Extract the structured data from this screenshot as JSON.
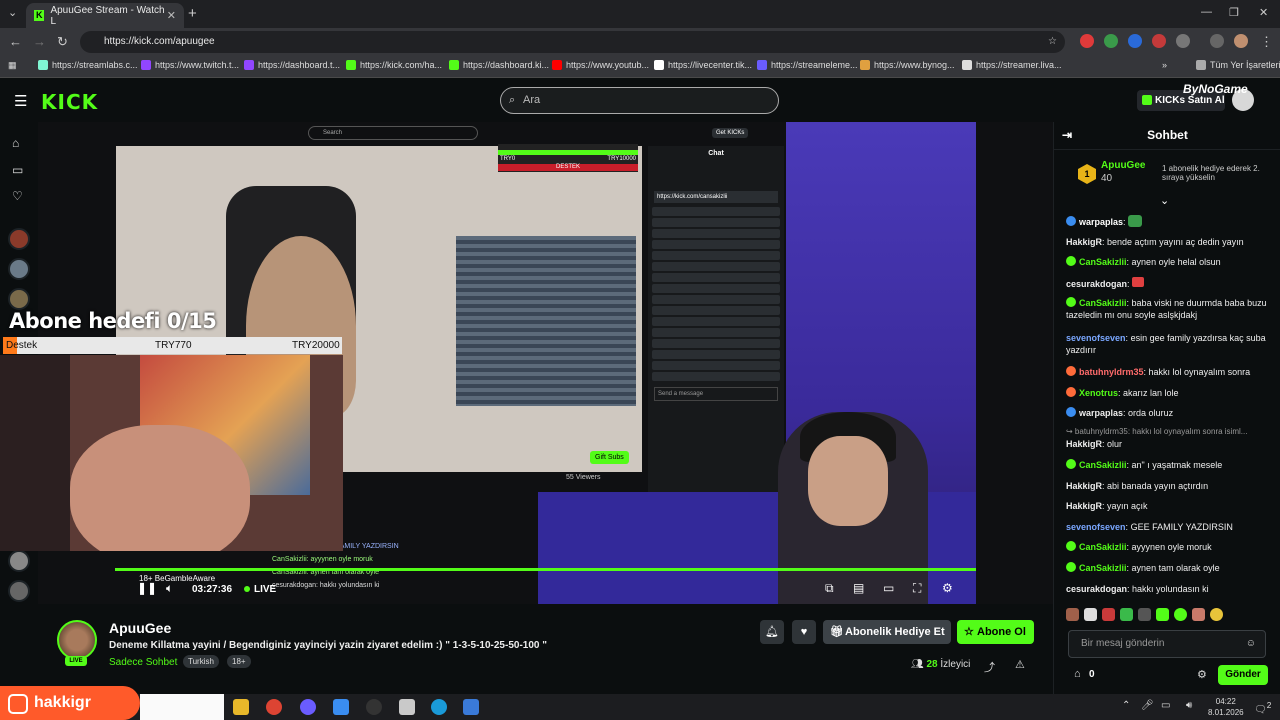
{
  "browser": {
    "tab_title": "ApuuGee Stream - Watch L",
    "tab_close": "✕",
    "new_tab": "+",
    "url": "https://kick.com/apuugee",
    "bookmarks": [
      {
        "label": "https://streamlabs.c...",
        "color": "#80f5d2"
      },
      {
        "label": "https://www.twitch.t...",
        "color": "#9146ff"
      },
      {
        "label": "https://dashboard.t...",
        "color": "#9146ff"
      },
      {
        "label": "https://kick.com/ha...",
        "color": "#53fc18"
      },
      {
        "label": "https://dashboard.ki...",
        "color": "#53fc18"
      },
      {
        "label": "https://www.youtub...",
        "color": "#ff0000"
      },
      {
        "label": "https://livecenter.tik...",
        "color": "#ffffff"
      },
      {
        "label": "https://streameleme...",
        "color": "#6a5cff"
      },
      {
        "label": "https://www.bynog...",
        "color": "#e0a040"
      },
      {
        "label": "https://streamer.liva...",
        "color": "#dddddd"
      }
    ],
    "all_bookmarks": "Tüm Yer İşaretleri"
  },
  "header": {
    "logo": "KICK",
    "search_placeholder": "Ara",
    "kicks_button": "KICKs Satın Al",
    "overlay_brand": "ByNoGame"
  },
  "stream_overlay": {
    "goal_title": "Abone hedefi 0/15",
    "goal_label": "Destek",
    "goal_mid": "TRY770",
    "goal_max": "TRY20000",
    "goal_progress": 0.04,
    "inner_search": "Search",
    "inner_chat": "Chat",
    "inner_get_kicks": "Get KICKs",
    "inner_gift": "Gift Subs",
    "inner_viewers": "55 Viewers",
    "inner_send": "Send a message",
    "inner_link": "https://kick.com/cansakizlii",
    "inner_bar_left": "TRY0",
    "inner_bar_right": "TRY10000",
    "inner_bar_label": "DESTEK",
    "overlay_chat": [
      "yaşatmak mesele",
      "yayın açtırdın",
      "sevenofseven: GEE FAMILY YAZDIRSIN",
      "CanSakizlii: ayyynen oyle moruk",
      "CanSakizlii: aynen tam olarak oyle",
      "cesurakdogan: hakkı yolundasın ki"
    ]
  },
  "player": {
    "age_notice": "18+ BeGambleAware",
    "time": "03:27:36",
    "live": "LIVE"
  },
  "streamer": {
    "name": "ApuuGee",
    "live_badge": "LIVE",
    "title": "Deneme Killatma yayini / Begendiginiz yayinciyi yazin ziyaret edelim :) \" 1-3-5-10-25-50-100 \"",
    "category": "Sadece Sohbet",
    "tags": [
      "Turkish",
      "18+"
    ],
    "gift_button": "Abonelik Hediye Et",
    "subscribe_button": "Abone Ol",
    "viewers_count": "28",
    "viewers_label": "İzleyici"
  },
  "chat": {
    "header": "Sohbet",
    "pinned_rank": "1",
    "pinned_user": "ApuuGee",
    "pinned_count": "40",
    "pinned_text": "1 abonelik hediye ederek 2. sıraya yükselin",
    "messages": [
      {
        "user": "warpaplas",
        "text": "",
        "color": "#ffffff",
        "badge": "#3a8df0"
      },
      {
        "user": "HakkigR",
        "text": "bende açtım yayını aç dedin yayın",
        "color": "#ffffff",
        "badge": ""
      },
      {
        "user": "CanSakizlii",
        "text": "aynen oyle helal olsun",
        "color": "#53fc18",
        "badge": "#53fc18"
      },
      {
        "user": "cesurakdogan",
        "text": "",
        "color": "#ffffff",
        "badge": ""
      },
      {
        "user": "CanSakizlii",
        "text": "baba viski ne duurmda baba buzu tazeledin mı onu soyle aslşkjdakj",
        "color": "#53fc18",
        "badge": "#53fc18"
      },
      {
        "user": "sevenofseven",
        "text": "esin gee family yazdırsa kaç suba yazdırır",
        "color": "#7aa7ff",
        "badge": ""
      },
      {
        "user": "batuhnyldrm35",
        "text": "hakkı lol oynayalım sonra",
        "color": "#ff6b6b",
        "badge": "#ff6b3a"
      },
      {
        "user": "Xenotrus",
        "text": "akarız lan lole",
        "color": "#53fc18",
        "badge": "#ff6b3a"
      },
      {
        "user": "warpaplas",
        "text": "orda oluruz",
        "color": "#ffffff",
        "badge": "#3a8df0"
      },
      {
        "user": "",
        "text": "↪ batuhnyldrm35: hakkı lol oynayalım sonra isiml...",
        "color": "#999999",
        "badge": ""
      },
      {
        "user": "HakkigR",
        "text": "olur",
        "color": "#ffffff",
        "badge": ""
      },
      {
        "user": "CanSakizlii",
        "text": "an\" ı yaşatmak mesele",
        "color": "#53fc18",
        "badge": "#53fc18"
      },
      {
        "user": "HakkigR",
        "text": "abi banada yayın açtırdın",
        "color": "#ffffff",
        "badge": ""
      },
      {
        "user": "HakkigR",
        "text": "yayın açık",
        "color": "#ffffff",
        "badge": ""
      },
      {
        "user": "sevenofseven",
        "text": "GEE FAMILY YAZDIRSIN",
        "color": "#7aa7ff",
        "badge": ""
      },
      {
        "user": "CanSakizlii",
        "text": "ayyynen oyle moruk",
        "color": "#53fc18",
        "badge": "#53fc18"
      },
      {
        "user": "CanSakizlii",
        "text": "aynen tam olarak oyle",
        "color": "#53fc18",
        "badge": "#53fc18"
      },
      {
        "user": "cesurakdogan",
        "text": "hakkı yolundasın ki",
        "color": "#ffffff",
        "badge": ""
      }
    ],
    "input_placeholder": "Bir mesaj gönderin",
    "kicks_count": "0",
    "send_button": "Gönder"
  },
  "taskbar": {
    "user_overlay": "hakkigr",
    "time": "04:22",
    "date": "8.01.2026",
    "notifications": "2"
  }
}
